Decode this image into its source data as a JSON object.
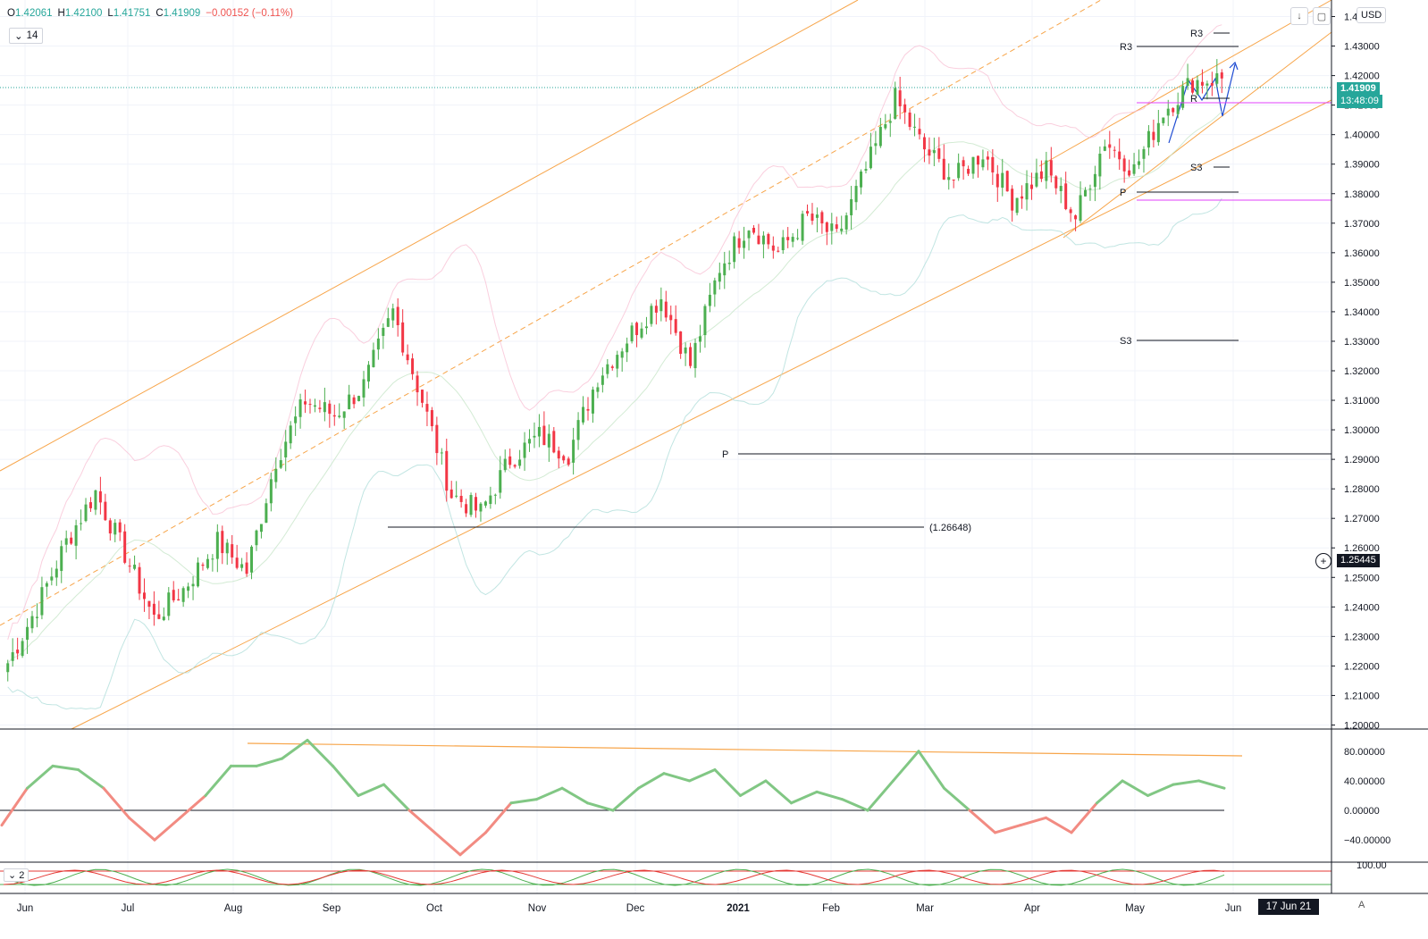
{
  "legend": {
    "o_label": "O",
    "o_val": "1.42061",
    "h_label": "H",
    "h_val": "1.42100",
    "l_label": "L",
    "l_val": "1.41751",
    "c_label": "C",
    "c_val": "1.41909",
    "change": "−0.00152 (−0.11%)"
  },
  "indicator_period": "14",
  "indicator2_period": "2",
  "currency_label": "USD",
  "toolbar_icons": [
    "arrow-down-icon",
    "maximize-icon"
  ],
  "price_axis": {
    "ticks": [
      "1.44000",
      "1.43000",
      "1.42000",
      "1.41000",
      "1.40000",
      "1.39000",
      "1.38000",
      "1.37000",
      "1.36000",
      "1.35000",
      "1.34000",
      "1.33000",
      "1.32000",
      "1.31000",
      "1.30000",
      "1.29000",
      "1.28000",
      "1.27000",
      "1.26000",
      "1.25000",
      "1.24000",
      "1.23000",
      "1.22000",
      "1.21000",
      "1.20000"
    ],
    "current_price": "1.41909",
    "countdown": "13:48:09",
    "cursor_price": "1.25445"
  },
  "osc_axis": {
    "ticks": [
      "80.00000",
      "40.00000",
      "0.00000",
      "−40.00000"
    ]
  },
  "osc2_axis": {
    "ticks": [
      "100.00"
    ]
  },
  "time_axis": {
    "labels": [
      "Jun",
      "Jul",
      "Aug",
      "Sep",
      "Oct",
      "Nov",
      "Dec",
      "2021",
      "Feb",
      "Mar",
      "Apr",
      "May",
      "Jun"
    ],
    "cursor_date": "17 Jun 21",
    "auto_label": "A"
  },
  "annotations": {
    "low_level": "(1.26648)",
    "pivot_left": "P",
    "r3_upper": "R3",
    "r3_lower": "R3",
    "s3_upper": "S3",
    "s3_lower": "S3",
    "p_right": "P",
    "r_mid": "R"
  },
  "colors": {
    "up": "#4caf50",
    "down": "#f23645",
    "channel": "#f7a54a",
    "pivot": "#131722",
    "magenta": "#e040fb",
    "price_tag": "#26a69a",
    "osc_up": "#81c784",
    "osc_down": "#f28b82"
  },
  "chart_data": {
    "type": "candlestick",
    "symbol_quote": "USD",
    "timeframe": "daily",
    "ylim": [
      1.195,
      1.445
    ],
    "x_months": [
      "Jun",
      "Jul",
      "Aug",
      "Sep",
      "Oct",
      "Nov",
      "Dec",
      "2021",
      "Feb",
      "Mar",
      "Apr",
      "May",
      "Jun"
    ],
    "close_path": [
      [
        "Jun",
        1.221
      ],
      [
        "Jun",
        1.24
      ],
      [
        "Jun",
        1.262
      ],
      [
        "Jun",
        1.279
      ],
      [
        "Jun",
        1.258
      ],
      [
        "Jul",
        1.236
      ],
      [
        "Jul",
        1.246
      ],
      [
        "Jul",
        1.262
      ],
      [
        "Jul",
        1.252
      ],
      [
        "Aug",
        1.29
      ],
      [
        "Aug",
        1.31
      ],
      [
        "Aug",
        1.305
      ],
      [
        "Aug",
        1.315
      ],
      [
        "Sep",
        1.34
      ],
      [
        "Sep",
        1.31
      ],
      [
        "Sep",
        1.278
      ],
      [
        "Oct",
        1.272
      ],
      [
        "Oct",
        1.29
      ],
      [
        "Oct",
        1.298
      ],
      [
        "Nov",
        1.292
      ],
      [
        "Nov",
        1.318
      ],
      [
        "Nov",
        1.333
      ],
      [
        "Dec",
        1.345
      ],
      [
        "Dec",
        1.322
      ],
      [
        "Dec",
        1.355
      ],
      [
        "2021",
        1.37
      ],
      [
        "2021",
        1.36
      ],
      [
        "2021",
        1.372
      ],
      [
        "Feb",
        1.365
      ],
      [
        "Feb",
        1.388
      ],
      [
        "Feb",
        1.412
      ],
      [
        "Mar",
        1.395
      ],
      [
        "Mar",
        1.385
      ],
      [
        "Mar",
        1.394
      ],
      [
        "Apr",
        1.378
      ],
      [
        "Apr",
        1.388
      ],
      [
        "Apr",
        1.372
      ],
      [
        "Apr",
        1.398
      ],
      [
        "May",
        1.388
      ],
      [
        "May",
        1.408
      ],
      [
        "May",
        1.418
      ],
      [
        "Jun",
        1.41909
      ]
    ],
    "levels": [
      {
        "label": "(1.26648)",
        "value": 1.26648
      },
      {
        "label": "P",
        "value": 1.292
      },
      {
        "label": "R3",
        "value": 1.4335
      },
      {
        "label": "R3",
        "value": 1.4385
      },
      {
        "label": "S3",
        "value": 1.3915
      },
      {
        "label": "S3",
        "value": 1.3315
      },
      {
        "label": "P",
        "value": 1.383
      }
    ],
    "oscillator": {
      "period": 14,
      "ylim": [
        -70,
        110
      ],
      "values": [
        -20,
        30,
        60,
        55,
        30,
        -10,
        -40,
        -10,
        20,
        60,
        60,
        70,
        95,
        60,
        20,
        35,
        0,
        -30,
        -60,
        -30,
        10,
        15,
        30,
        10,
        0,
        30,
        50,
        40,
        55,
        20,
        40,
        10,
        25,
        15,
        0,
        40,
        80,
        30,
        0,
        -30,
        -20,
        -10,
        -30,
        10,
        40,
        20,
        35,
        40,
        30
      ]
    }
  }
}
